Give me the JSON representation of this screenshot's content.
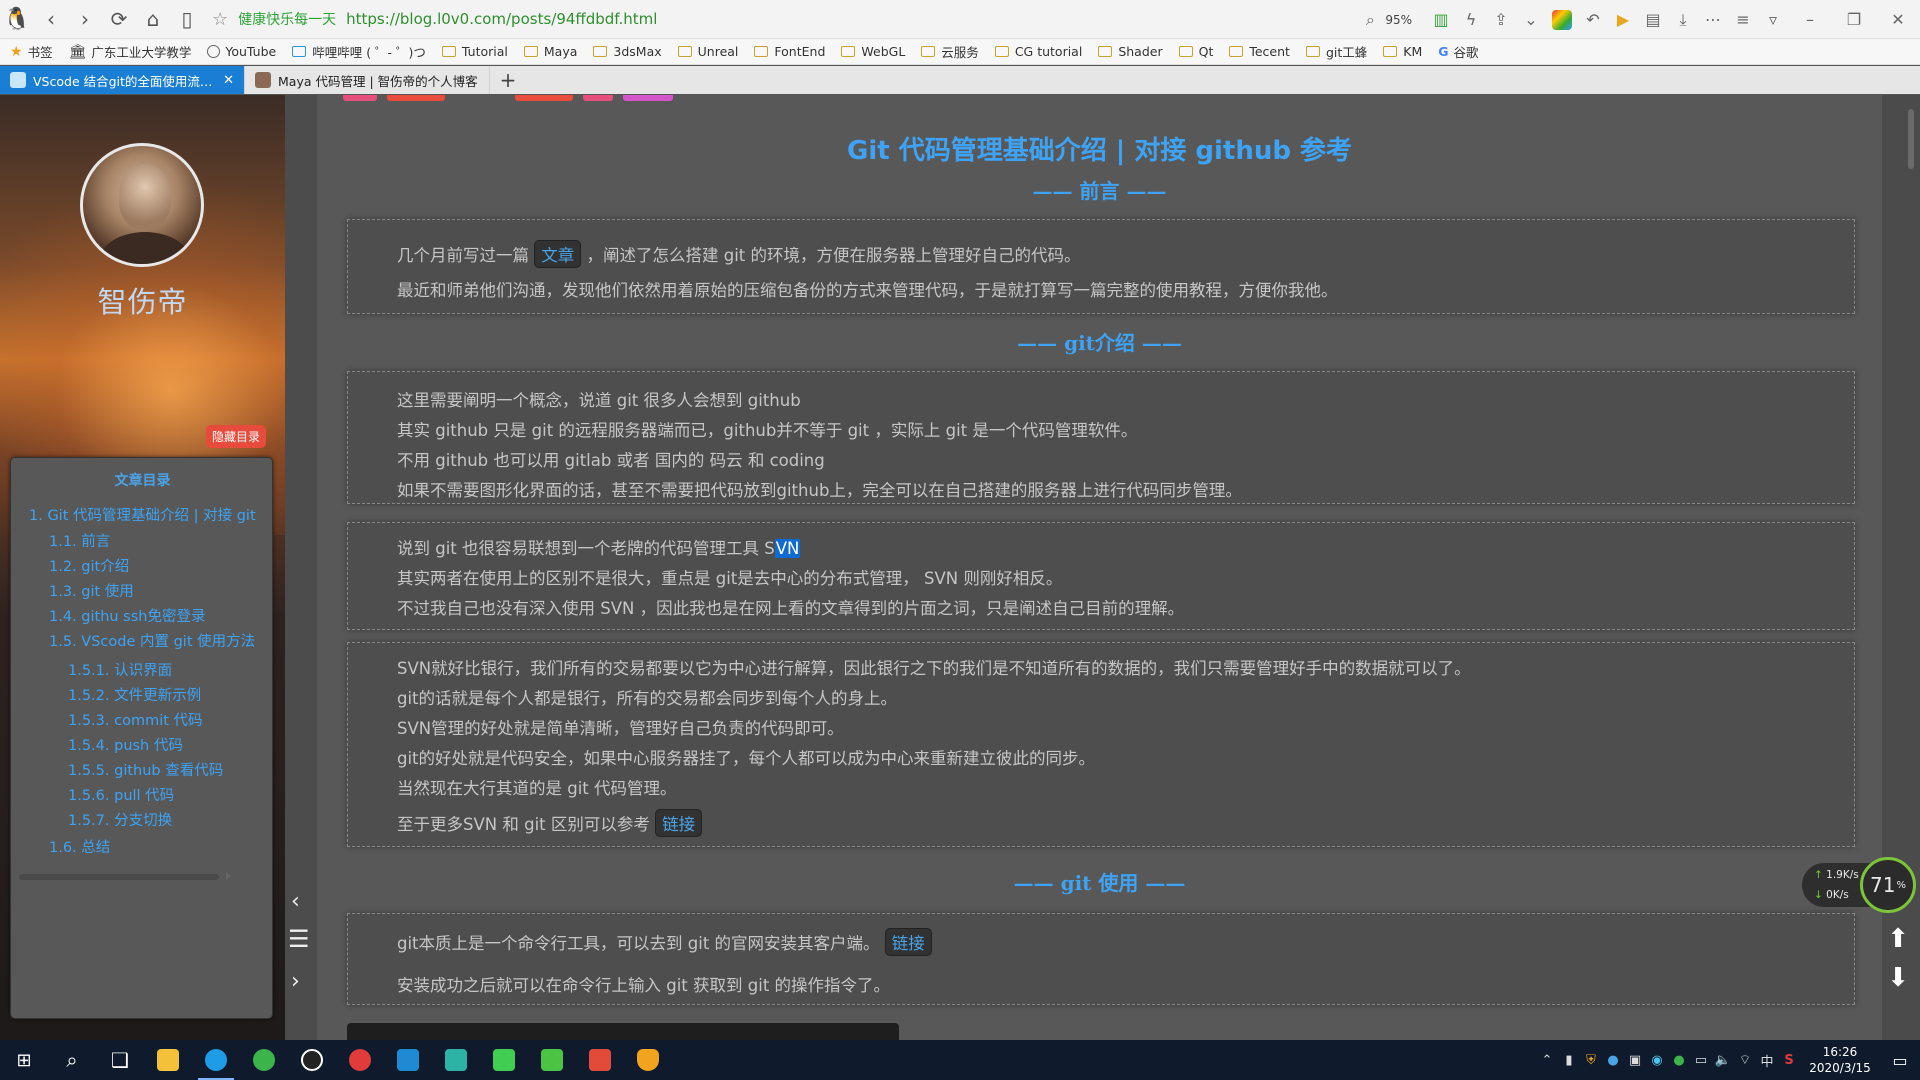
{
  "browser": {
    "slogan": "健康快乐每一天",
    "url": "https://blog.l0v0.com/posts/94ffdbdf.html",
    "zoom": "95%",
    "bookmarks": [
      "书签",
      "广东工业大学教学",
      "YouTube",
      "哔哩哔哩 ( ゜- ゜)つ",
      "Tutorial",
      "Maya",
      "3dsMax",
      "Unreal",
      "FontEnd",
      "WebGL",
      "云服务",
      "CG tutorial",
      "Shader",
      "Qt",
      "Tecent",
      "git工蜂",
      "KM",
      "谷歌"
    ],
    "tabs": [
      {
        "title": "VScode 结合git的全面使用流程 | 智伤帝"
      },
      {
        "title": "Maya 代码管理 | 智伤帝的个人博客"
      }
    ]
  },
  "sidebar": {
    "author": "智伤帝",
    "hide_toc": "隐藏目录",
    "toc_title": "文章目录",
    "toc": [
      {
        "text": "1. Git 代码管理基础介绍 | 对接 git",
        "level": 1
      },
      {
        "text": "1.1. 前言",
        "level": 2
      },
      {
        "text": "1.2. git介绍",
        "level": 2
      },
      {
        "text": "1.3. git 使用",
        "level": 2
      },
      {
        "text": "1.4. githu ssh免密登录",
        "level": 2
      },
      {
        "text": "1.5. VScode 内置 git 使用方法",
        "level": 2
      },
      {
        "text": "1.5.1. 认识界面",
        "level": 3
      },
      {
        "text": "1.5.2. 文件更新示例",
        "level": 3
      },
      {
        "text": "1.5.3. commit 代码",
        "level": 3
      },
      {
        "text": "1.5.4. push 代码",
        "level": 3
      },
      {
        "text": "1.5.5. github 查看代码",
        "level": 3
      },
      {
        "text": "1.5.6. pull 代码",
        "level": 3
      },
      {
        "text": "1.5.7. 分支切换",
        "level": 3
      },
      {
        "text": "1.6. 总结",
        "level": 2
      }
    ]
  },
  "article": {
    "title": "Git 代码管理基础介绍 | 对接 github 参考",
    "sections": [
      {
        "title": "—— 前言 ——"
      },
      {
        "title": "—— git介绍 ——"
      },
      {
        "title": "—— git 使用 ——"
      }
    ],
    "p1": {
      "a": "几个月前写过一篇",
      "link": "文章",
      "b": "，阐述了怎么搭建 git 的环境，方便在服务器上管理好自己的代码。",
      "c": "最近和师弟他们沟通，发现他们依然用着原始的压缩包备份的方式来管理代码，于是就打算写一篇完整的使用教程，方便你我他。"
    },
    "p2": [
      "这里需要阐明一个概念，说道 git 很多人会想到 github",
      "其实 github 只是 git 的远程服务器端而已，github并不等于 git ，实际上 git 是一个代码管理软件。",
      "不用 github 也可以用 gitlab 或者 国内的 码云 和 coding",
      "如果不需要图形化界面的话，甚至不需要把代码放到github上，完全可以在自己搭建的服务器上进行代码同步管理。"
    ],
    "p3": {
      "a": "说到 git 也很容易联想到一个老牌的代码管理工具 S",
      "hl": "VN",
      "b": "其实两者在使用上的区别不是很大，重点是 git是去中心的分布式管理， SVN 则刚好相反。",
      "c": "不过我自己也没有深入使用 SVN ，因此我也是在网上看的文章得到的片面之词，只是阐述自己目前的理解。"
    },
    "p4": [
      "SVN就好比银行，我们所有的交易都要以它为中心进行解算，因此银行之下的我们是不知道所有的数据的，我们只需要管理好手中的数据就可以了。",
      "git的话就是每个人都是银行，所有的交易都会同步到每个人的身上。",
      "SVN管理的好处就是简单清晰，管理好自己负责的代码即可。",
      "git的好处就是代码安全，如果中心服务器挂了，每个人都可以成为中心来重新建立彼此的同步。",
      "当然现在大行其道的是 git 代码管理。"
    ],
    "p4_link": {
      "a": "至于更多SVN 和 git 区别可以参考",
      "link": "链接"
    },
    "p5": {
      "a": "git本质上是一个命令行工具，可以去到 git 的官网安装其客户端。",
      "link": "链接",
      "b": "安装成功之后就可以在命令行上输入 git 获取到 git 的操作指令了。"
    }
  },
  "netgauge": {
    "up": "1.9K/s",
    "down": "0K/s",
    "percent": "71"
  },
  "taskbar": {
    "time": "16:26",
    "date": "2020/3/15",
    "ime": "中"
  }
}
